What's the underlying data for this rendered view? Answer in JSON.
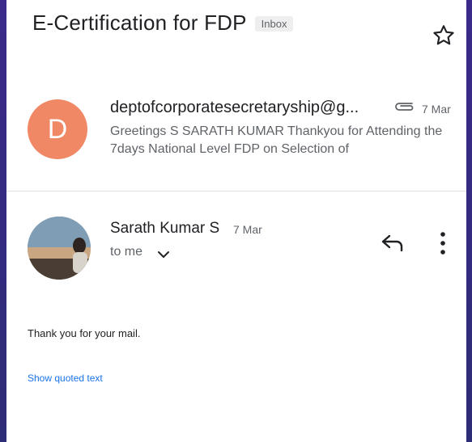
{
  "header": {
    "subject": "E-Certification for FDP",
    "label": "Inbox"
  },
  "messages": [
    {
      "avatar_letter": "D",
      "sender": "deptofcorporatesecretaryship@g...",
      "date": "7 Mar",
      "snippet": "Greetings S SARATH KUMAR Thankyou for Attending the 7days National Level FDP on Selection of"
    },
    {
      "sender": "Sarath Kumar S",
      "date": "7 Mar",
      "recipient": "to me",
      "body": "Thank you for your mail.",
      "show_quoted": "Show quoted text"
    }
  ],
  "icons": {
    "star": "star-icon",
    "attachment": "paperclip-icon",
    "reply": "reply-icon",
    "more": "more-vert-icon",
    "expand": "chevron-down-icon"
  },
  "colors": {
    "avatar_d": "#f08866",
    "link": "#1a73e8",
    "frame": "#2d2c76"
  }
}
